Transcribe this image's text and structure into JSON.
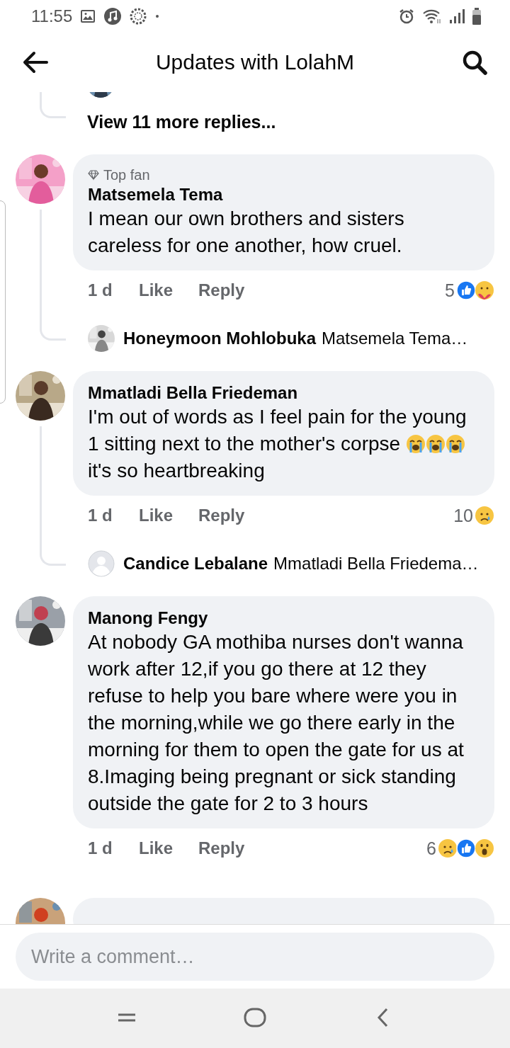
{
  "status_bar": {
    "time": "11:55"
  },
  "header": {
    "title": "Updates with LolahM"
  },
  "thread_top": {
    "view_more": "View 11 more replies..."
  },
  "comments": [
    {
      "badge": "Top fan",
      "author": "Matsemela Tema",
      "body": [
        {
          "kind": "text",
          "text": "I mean our own brothers and sisters careless for one another, how cruel."
        }
      ],
      "time": "1 d",
      "like": "Like",
      "reply": "Reply",
      "reaction_count": "5",
      "reactions": [
        {
          "kind": "like"
        },
        {
          "kind": "care"
        }
      ],
      "replies": [
        {
          "author": "Honeymoon Mohlobuka",
          "text": "Matsemela Tema…"
        }
      ]
    },
    {
      "author": "Mmatladi Bella Friedeman",
      "body": [
        {
          "kind": "text",
          "text": "I'm out of words as I feel pain for the young 1 sitting next to the mother's corpse "
        },
        {
          "kind": "crying"
        },
        {
          "kind": "crying"
        },
        {
          "kind": "crying"
        },
        {
          "kind": "text",
          "text": " it's so heartbreaking"
        }
      ],
      "time": "1 d",
      "like": "Like",
      "reply": "Reply",
      "reaction_count": "10",
      "reactions": [
        {
          "kind": "sad"
        }
      ],
      "replies": [
        {
          "kind": "placeholder",
          "author": "Candice Lebalane",
          "text": "Mmatladi Bella Friedema…"
        }
      ]
    },
    {
      "author": "Manong Fengy",
      "body": [
        {
          "kind": "text",
          "text": "At nobody GA mothiba nurses don't wanna work after 12,if you go there at 12 they refuse to help you bare where were you in the morning,while we go there early in the morning for them to open the gate for us at 8.Imaging being pregnant or sick standing outside the gate for 2 to 3 hours"
        }
      ],
      "time": "1 d",
      "like": "Like",
      "reply": "Reply",
      "reaction_count": "6",
      "reactions": [
        {
          "kind": "sad"
        },
        {
          "kind": "like"
        },
        {
          "kind": "wow"
        }
      ]
    }
  ],
  "composer": {
    "placeholder": "Write a comment…"
  }
}
